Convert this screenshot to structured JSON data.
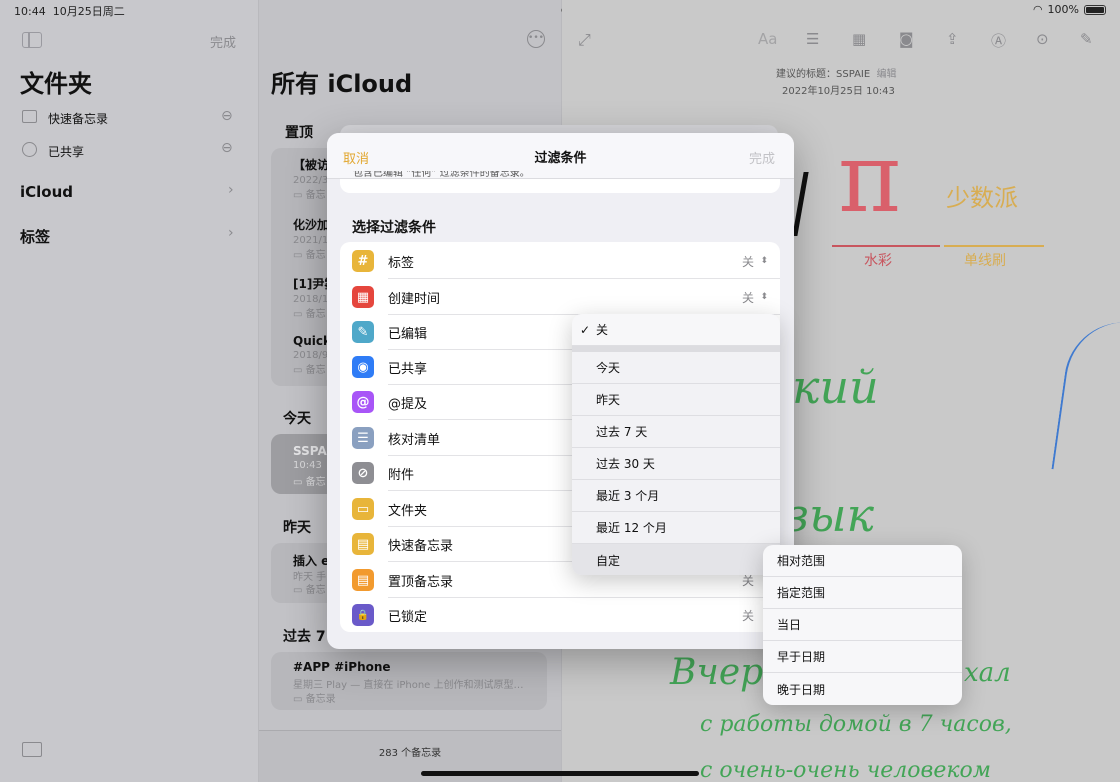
{
  "status": {
    "time": "10:44",
    "date": "10月25日周二",
    "battery": "100%"
  },
  "sidebar": {
    "done": "完成",
    "title": "文件夹",
    "items": [
      {
        "label": "快速备忘录"
      },
      {
        "label": "已共享"
      }
    ],
    "sections": [
      {
        "label": "iCloud"
      },
      {
        "label": "标签"
      }
    ]
  },
  "list": {
    "title": "所有 iCloud",
    "pinned": "置顶",
    "pinned_items": [
      {
        "title": "【被访",
        "date": "2022/3",
        "folder": "备忘"
      },
      {
        "title": "化沙加",
        "date": "2021/1",
        "folder": "备忘"
      },
      {
        "title": "[1]尹雾",
        "date": "2018/1",
        "folder": "备忘"
      },
      {
        "title": "Quick",
        "date": "2018/9",
        "folder": "备忘"
      }
    ],
    "today": "今天",
    "today_item": {
      "title": "SSPA",
      "date": "10:43",
      "folder": "备忘"
    },
    "yesterday": "昨天",
    "yesterday_item": {
      "title": "插入 e",
      "date": "昨天 手",
      "folder": "备忘"
    },
    "last7": "过去 7",
    "last7_item": {
      "title": "#APP #iPhone",
      "preview": "星期三  Play — 直接在 iPhone 上创作和测试原型…",
      "folder": "备忘录"
    },
    "count": "283 个备忘录"
  },
  "note": {
    "suggest": "建议的标题：SSPAIE",
    "edit": "编辑",
    "date": "2022年10月25日 10:43",
    "hw_pi": "π",
    "hw_zh1": "少数派",
    "hw_zh2": "水彩",
    "hw_zh3": "单线刷",
    "hw_ru1": "кий",
    "hw_ru2": "зык",
    "hw_ru3": "Вчера",
    "hw_ru4": "хал",
    "hw_ru5": "с работы домой в 7 часов,",
    "hw_ru6": "с очень-очень человеком"
  },
  "modal": {
    "cancel": "取消",
    "title": "过滤条件",
    "done": "完成",
    "top_text": "包含已编辑 “任何” 过滤条件的备忘录。",
    "section": "选择过滤条件",
    "rows": [
      {
        "label": "标签",
        "value": "关",
        "color": "#e8b53a",
        "glyph": "#"
      },
      {
        "label": "创建时间",
        "value": "关",
        "color": "#e5463d",
        "glyph": "▦"
      },
      {
        "label": "已编辑",
        "value": "",
        "color": "#4fa8c9",
        "glyph": "✎"
      },
      {
        "label": "已共享",
        "value": "",
        "color": "#2f7cf6",
        "glyph": "◉"
      },
      {
        "label": "@提及",
        "value": "",
        "color": "#a855f7",
        "glyph": "@"
      },
      {
        "label": "核对清单",
        "value": "",
        "color": "#8aa0c0",
        "glyph": "☰"
      },
      {
        "label": "附件",
        "value": "",
        "color": "#8e8e93",
        "glyph": "⊘"
      },
      {
        "label": "文件夹",
        "value": "",
        "color": "#e8b53a",
        "glyph": "▭"
      },
      {
        "label": "快速备忘录",
        "value": "",
        "color": "#e8b53a",
        "glyph": "▤"
      },
      {
        "label": "置顶备忘录",
        "value": "关",
        "color": "#f29a2e",
        "glyph": "▤"
      },
      {
        "label": "已锁定",
        "value": "关",
        "color": "#6a5ac9",
        "glyph": "🔒"
      }
    ]
  },
  "dropdown": {
    "checked": "关",
    "options": [
      "今天",
      "昨天",
      "过去 7 天",
      "过去 30 天",
      "最近 3 个月",
      "最近 12 个月",
      "自定"
    ]
  },
  "submenu": {
    "options": [
      "相对范围",
      "指定范围",
      "当日",
      "早于日期",
      "晚于日期"
    ]
  }
}
